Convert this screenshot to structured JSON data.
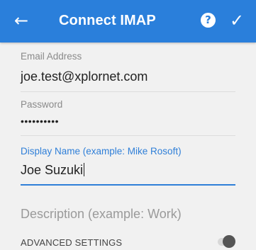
{
  "appbar": {
    "back_icon": "←",
    "title": "Connect IMAP",
    "help_icon": "?",
    "confirm_icon": "✓"
  },
  "form": {
    "email": {
      "label": "Email Address",
      "value": "joe.test@xplornet.com"
    },
    "password": {
      "label": "Password",
      "value": "••••••••••"
    },
    "display_name": {
      "label": "Display Name (example: Mike Rosoft)",
      "value": "Joe Suzuki"
    },
    "description": {
      "placeholder": "Description (example: Work)"
    },
    "advanced": {
      "label": "ADVANCED SETTINGS",
      "enabled": false
    }
  },
  "colors": {
    "appbar": "#2a7fdb",
    "accent": "#2f7fd8"
  }
}
